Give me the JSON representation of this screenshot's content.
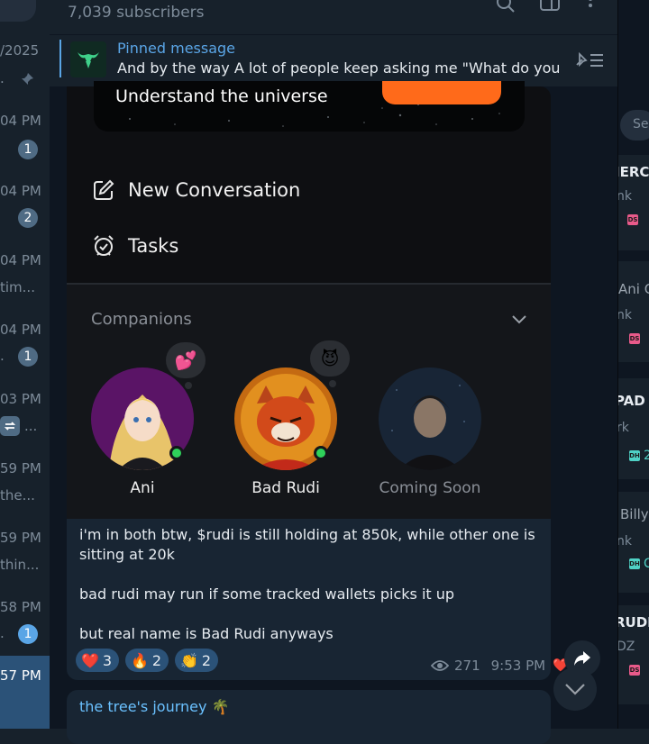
{
  "chat_list": {
    "items": [
      {
        "time": "/2025",
        "snippet": "."
      },
      {
        "time": "04 PM",
        "badge": "1"
      },
      {
        "time": "04 PM",
        "badge": "2"
      },
      {
        "time": "04 PM",
        "snippet": "tim..."
      },
      {
        "time": "04 PM",
        "snippet": ".",
        "badge": "1"
      },
      {
        "time": "03 PM",
        "snippet": "..."
      },
      {
        "time": "59 PM",
        "snippet": "the..."
      },
      {
        "time": "59 PM",
        "snippet": "thin..."
      },
      {
        "time": "58 PM",
        "snippet": ".",
        "badge": "1"
      },
      {
        "time": "57 PM"
      }
    ]
  },
  "channel": {
    "subscribers": "7,039 subscribers"
  },
  "pinned": {
    "title": "Pinned message",
    "text": "And by the way  A lot of people keep asking me  \"What do you ..."
  },
  "post_image": {
    "banner_text": "Understand the universe",
    "menu": [
      {
        "label": "New Conversation",
        "icon": "edit-icon"
      },
      {
        "label": "Tasks",
        "icon": "alarm-icon"
      }
    ],
    "companions_label": "Companions",
    "companions": [
      {
        "name": "Ani",
        "emoji": "💕",
        "online": true
      },
      {
        "name": "Bad Rudi",
        "emoji": "😈",
        "online": true
      },
      {
        "name": "Coming Soon",
        "emoji": "",
        "online": false
      }
    ]
  },
  "message": {
    "lines": [
      "i'm in both btw, $rudi is still holding at 850k, while other one is",
      "sitting at 20k",
      "",
      "bad rudi may run if some tracked wallets picks it up",
      "",
      "but real name is Bad Rudi anyways"
    ],
    "reactions": [
      {
        "emoji": "❤️",
        "count": "3"
      },
      {
        "emoji": "🔥",
        "count": "2"
      },
      {
        "emoji": "👏",
        "count": "2"
      }
    ],
    "views": "271",
    "time": "9:53 PM",
    "my_reaction": "❤️"
  },
  "next_message": {
    "title": "the tree's journey 🌴"
  },
  "right_panel": {
    "search_placeholder": "Sea",
    "items": [
      {
        "title": "IERC",
        "sub": "nk"
      },
      {
        "title": "Ani C",
        "sub": "nk"
      },
      {
        "title": "PAD",
        "sub": "rk"
      },
      {
        "title": "Billy",
        "sub": "nk"
      },
      {
        "title": "RUDI",
        "sub": "DZ"
      }
    ],
    "tags": [
      "DS",
      "DS",
      "DH",
      "DH",
      "DS"
    ],
    "tag_values": [
      "2",
      "C"
    ]
  },
  "colors": {
    "accent": "#5aa5e6",
    "bubble": "#182533",
    "background": "#0e1621",
    "online": "#2fd15a",
    "reaction_bg": "#2b5278"
  }
}
